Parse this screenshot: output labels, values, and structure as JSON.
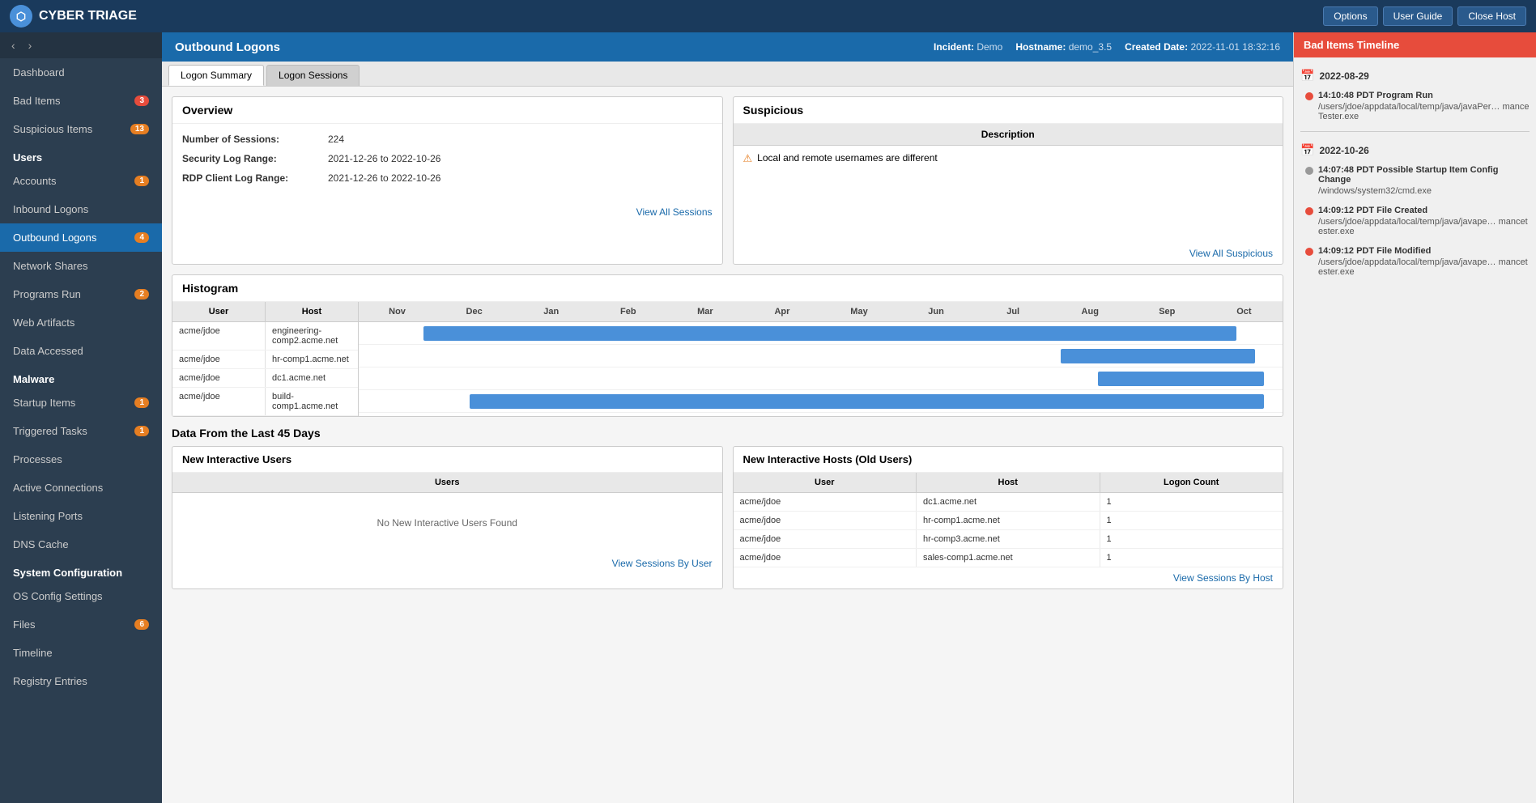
{
  "app": {
    "name": "CYBER TRIAGE",
    "logo_symbol": "CT"
  },
  "header_buttons": [
    "Options",
    "User Guide",
    "Close Host"
  ],
  "incident": {
    "label": "Incident:",
    "name": "Demo",
    "hostname_label": "Hostname:",
    "hostname": "demo_3.5",
    "created_label": "Created Date:",
    "created": "2022-11-01 18:32:16"
  },
  "content_title": "Outbound Logons",
  "tabs": [
    "Logon Summary",
    "Logon Sessions"
  ],
  "active_tab": "Logon Summary",
  "sidebar": {
    "nav_back": "‹",
    "nav_forward": "›",
    "items": [
      {
        "label": "Dashboard",
        "type": "item",
        "badge": null
      },
      {
        "label": "Bad Items",
        "type": "item",
        "badge": "3",
        "badge_color": "red"
      },
      {
        "label": "Suspicious Items",
        "type": "item",
        "badge": "13",
        "badge_color": "orange"
      },
      {
        "label": "Users",
        "type": "section"
      },
      {
        "label": "Accounts",
        "type": "item",
        "badge": "1",
        "badge_color": "orange"
      },
      {
        "label": "Inbound Logons",
        "type": "item",
        "badge": null
      },
      {
        "label": "Outbound Logons",
        "type": "item",
        "badge": "4",
        "badge_color": "orange",
        "active": true
      },
      {
        "label": "Network Shares",
        "type": "item",
        "badge": null
      },
      {
        "label": "Programs Run",
        "type": "item",
        "badge": "2",
        "badge_color": "orange"
      },
      {
        "label": "Web Artifacts",
        "type": "item",
        "badge": null
      },
      {
        "label": "Data Accessed",
        "type": "item",
        "badge": null
      },
      {
        "label": "Malware",
        "type": "section"
      },
      {
        "label": "Startup Items",
        "type": "item",
        "badge": "1",
        "badge_color": "orange"
      },
      {
        "label": "Triggered Tasks",
        "type": "item",
        "badge": "1",
        "badge_color": "orange"
      },
      {
        "label": "Processes",
        "type": "item",
        "badge": null
      },
      {
        "label": "Active Connections",
        "type": "item",
        "badge": null
      },
      {
        "label": "Listening Ports",
        "type": "item",
        "badge": null
      },
      {
        "label": "DNS Cache",
        "type": "item",
        "badge": null
      },
      {
        "label": "System Configuration",
        "type": "section"
      },
      {
        "label": "OS Config Settings",
        "type": "item",
        "badge": null
      },
      {
        "label": "Files",
        "type": "item",
        "badge": "6",
        "badge_color": "orange"
      },
      {
        "label": "Timeline",
        "type": "item",
        "badge": null
      },
      {
        "label": "Registry Entries",
        "type": "item",
        "badge": null
      }
    ]
  },
  "overview": {
    "title": "Overview",
    "fields": [
      {
        "label": "Number of Sessions:",
        "value": "224"
      },
      {
        "label": "Security Log Range:",
        "value": "2021-12-26 to 2022-10-26"
      },
      {
        "label": "RDP Client Log Range:",
        "value": "2021-12-26 to 2022-10-26"
      }
    ],
    "view_link": "View All Sessions"
  },
  "suspicious": {
    "title": "Suspicious",
    "col_header": "Description",
    "items": [
      {
        "icon": "⚠",
        "text": "Local and remote usernames are different"
      }
    ],
    "view_link": "View All Suspicious"
  },
  "histogram": {
    "title": "Histogram",
    "col_user": "User",
    "col_host": "Host",
    "months": [
      "Nov",
      "Dec",
      "Jan",
      "Feb",
      "Mar",
      "Apr",
      "May",
      "Jun",
      "Jul",
      "Aug",
      "Sep",
      "Oct"
    ],
    "rows": [
      {
        "user": "acme/jdoe",
        "host": "engineering-comp2.acme.net",
        "bar_start_pct": 8,
        "bar_width_pct": 88
      },
      {
        "user": "acme/jdoe",
        "host": "hr-comp1.acme.net",
        "bar_start_pct": 76,
        "bar_width_pct": 20
      },
      {
        "user": "acme/jdoe",
        "host": "dc1.acme.net",
        "bar_start_pct": 80,
        "bar_width_pct": 18
      },
      {
        "user": "acme/jdoe",
        "host": "build-comp1.acme.net",
        "bar_start_pct": 12,
        "bar_width_pct": 86
      }
    ]
  },
  "data_last_45": {
    "title": "Data From the Last 45 Days",
    "new_interactive_users": {
      "title": "New Interactive Users",
      "col_header": "Users",
      "empty_text": "No New Interactive Users Found",
      "view_link": "View Sessions By User"
    },
    "new_interactive_hosts": {
      "title": "New Interactive Hosts (Old Users)",
      "col_user": "User",
      "col_host": "Host",
      "col_logon": "Logon Count",
      "rows": [
        {
          "user": "acme/jdoe",
          "host": "dc1.acme.net",
          "count": "1"
        },
        {
          "user": "acme/jdoe",
          "host": "hr-comp1.acme.net",
          "count": "1"
        },
        {
          "user": "acme/jdoe",
          "host": "hr-comp3.acme.net",
          "count": "1"
        },
        {
          "user": "acme/jdoe",
          "host": "sales-comp1.acme.net",
          "count": "1"
        }
      ],
      "view_link": "View Sessions By Host"
    }
  },
  "right_sidebar": {
    "title": "Bad Items Timeline",
    "dates": [
      {
        "date": "2022-08-29",
        "events": [
          {
            "time": "14:10:48 PDT Program Run",
            "path": "/users/jdoe/appdata/local/temp/java/javaPer…\nmanceTester.exe",
            "dot_color": "red"
          }
        ]
      },
      {
        "date": "2022-10-26",
        "events": [
          {
            "time": "14:07:48 PDT Possible Startup Item Config Change",
            "path": "/windows/system32/cmd.exe",
            "dot_color": "gray"
          },
          {
            "time": "14:09:12 PDT File Created",
            "path": "/users/jdoe/appdata/local/temp/java/javape…\nmancetester.exe",
            "dot_color": "red"
          },
          {
            "time": "14:09:12 PDT File Modified",
            "path": "/users/jdoe/appdata/local/temp/java/javape…\nmancetester.exe",
            "dot_color": "red"
          }
        ]
      }
    ]
  }
}
